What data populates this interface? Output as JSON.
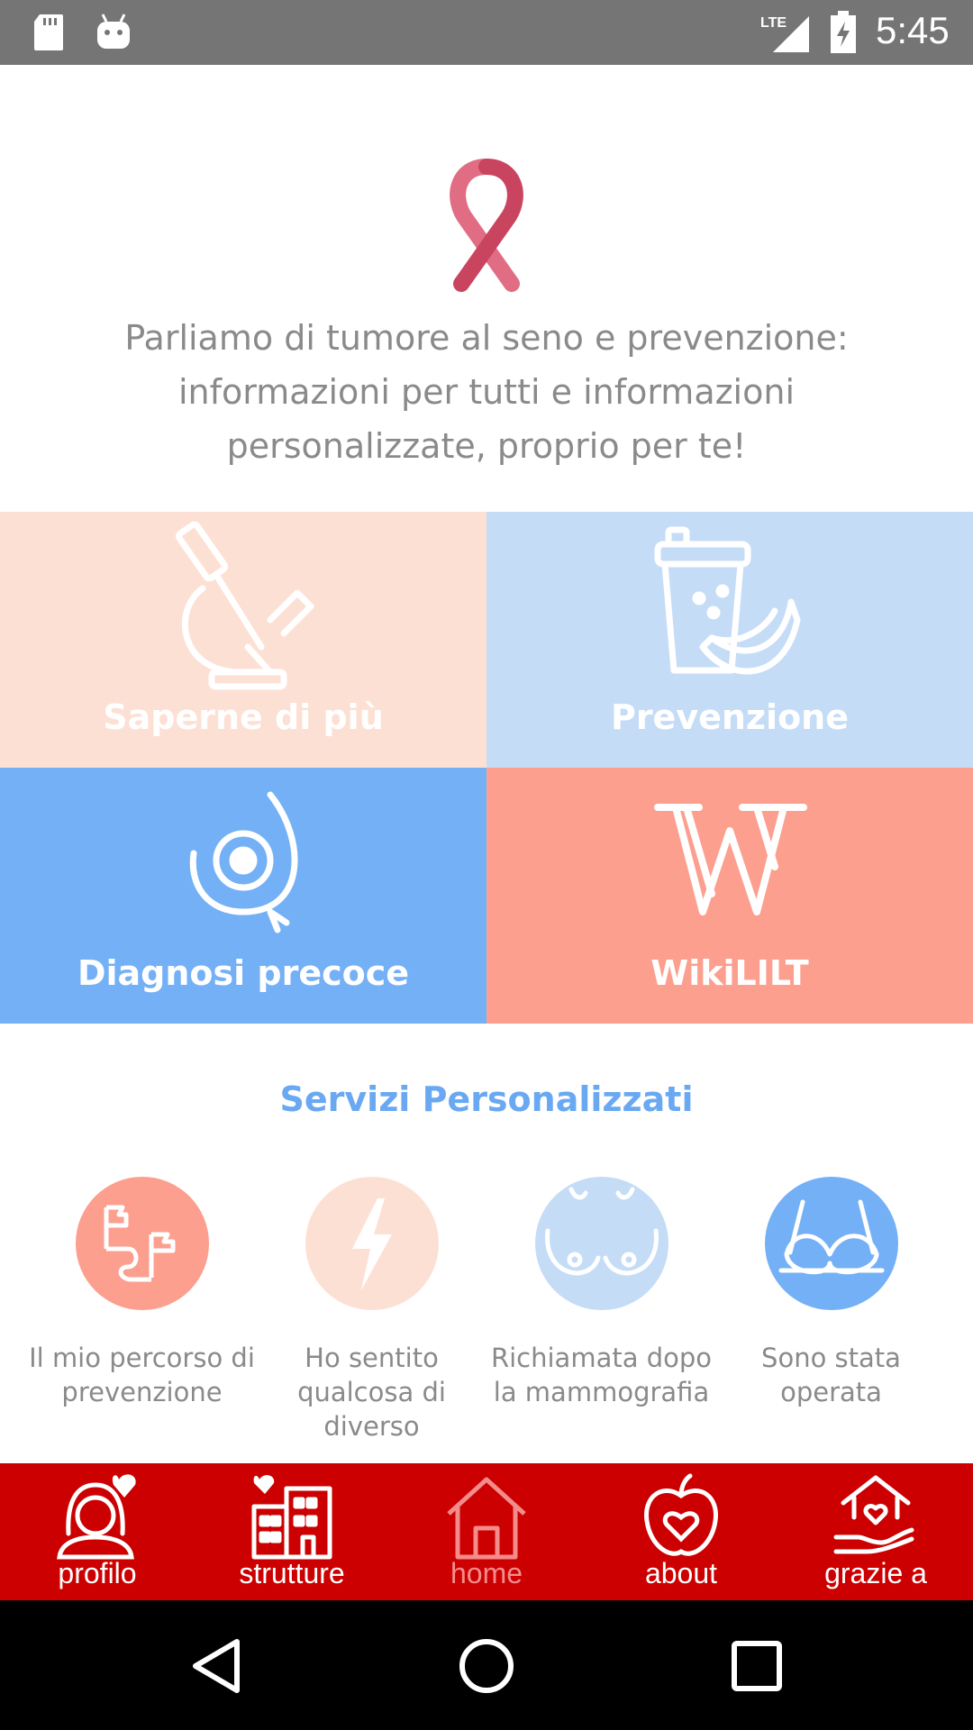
{
  "status_bar": {
    "time": "5:45",
    "network": "LTE",
    "icons": [
      "sd-card-icon",
      "android-icon",
      "lte-signal-icon",
      "battery-charging-icon"
    ]
  },
  "hero": {
    "icon": "pink-ribbon-icon",
    "text": "Parliamo di tumore al seno e prevenzione: informazioni per tutti e informazioni personalizzate, proprio per te!"
  },
  "tiles": [
    {
      "label": "Saperne di più",
      "icon": "microscope-icon",
      "color": "#fde0d4"
    },
    {
      "label": "Prevenzione",
      "icon": "smoothie-banana-icon",
      "color": "#c5dcf7"
    },
    {
      "label": "Diagnosi precoce",
      "icon": "breast-check-icon",
      "color": "#74b0f6"
    },
    {
      "label": "WikiLILT",
      "icon": "wiki-w-icon",
      "color": "#fc9f8f"
    }
  ],
  "services": {
    "title": "Servizi Personalizzati",
    "items": [
      {
        "label": "Il mio percorso di prevenzione",
        "icon": "flags-path-icon",
        "color": "#fc9f8f"
      },
      {
        "label": "Ho sentito qualcosa di diverso",
        "icon": "lightning-icon",
        "color": "#fde0d4"
      },
      {
        "label": "Richiamata dopo la mammografia",
        "icon": "breasts-icon",
        "color": "#c5dcf7"
      },
      {
        "label": "Sono stata operata",
        "icon": "bra-icon",
        "color": "#74b0f6"
      }
    ]
  },
  "bottom_nav": {
    "color": "#cc0000",
    "items": [
      {
        "label": "profilo",
        "icon": "profile-heart-icon"
      },
      {
        "label": "strutture",
        "icon": "buildings-icon"
      },
      {
        "label": "home",
        "icon": "home-icon",
        "active": true
      },
      {
        "label": "about",
        "icon": "apple-heart-icon"
      },
      {
        "label": "grazie a",
        "icon": "hands-house-icon"
      }
    ]
  },
  "system_nav": {
    "icons": [
      "back-icon",
      "home-circle-icon",
      "recents-icon"
    ]
  }
}
